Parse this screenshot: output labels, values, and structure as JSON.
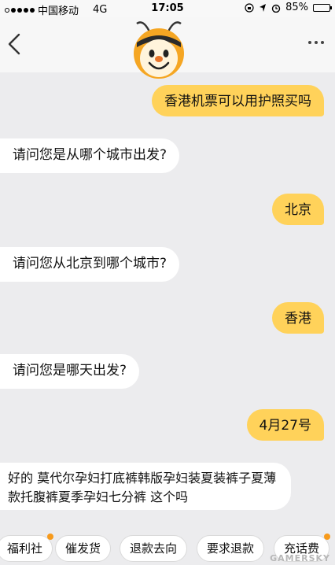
{
  "status_bar": {
    "carrier": "中国移动",
    "network": "4G",
    "time": "17:05",
    "battery": "85%",
    "battery_level": 0.85
  },
  "nav": {
    "back_icon": "chevron-left-icon",
    "more_icon": "more-dots-icon",
    "avatar_icon": "bee-mascot-icon"
  },
  "messages": [
    {
      "side": "right",
      "text": "香港机票可以用护照买吗"
    },
    {
      "side": "left",
      "text": "请问您是从哪个城市出发?"
    },
    {
      "side": "right",
      "text": "北京"
    },
    {
      "side": "left",
      "text": "请问您从北京到哪个城市?"
    },
    {
      "side": "right",
      "text": "香港"
    },
    {
      "side": "left",
      "text": "请问您是哪天出发?"
    },
    {
      "side": "right",
      "text": "4月27号"
    },
    {
      "side": "left",
      "text": "好的 莫代尔孕妇打底裤韩版孕妇装夏装裤子夏薄款托腹裤夏季孕妇七分裤 这个吗"
    }
  ],
  "quick_actions": [
    {
      "label": "福利社",
      "badge": true
    },
    {
      "label": "催发货",
      "badge": false
    },
    {
      "label": "退款去向",
      "badge": false
    },
    {
      "label": "要求退款",
      "badge": false
    },
    {
      "label": "充话费",
      "badge": true
    }
  ],
  "watermark": "GAMERSKY",
  "colors": {
    "accent": "#ffd25a",
    "badge": "#f79a1b",
    "background": "#ececee"
  }
}
